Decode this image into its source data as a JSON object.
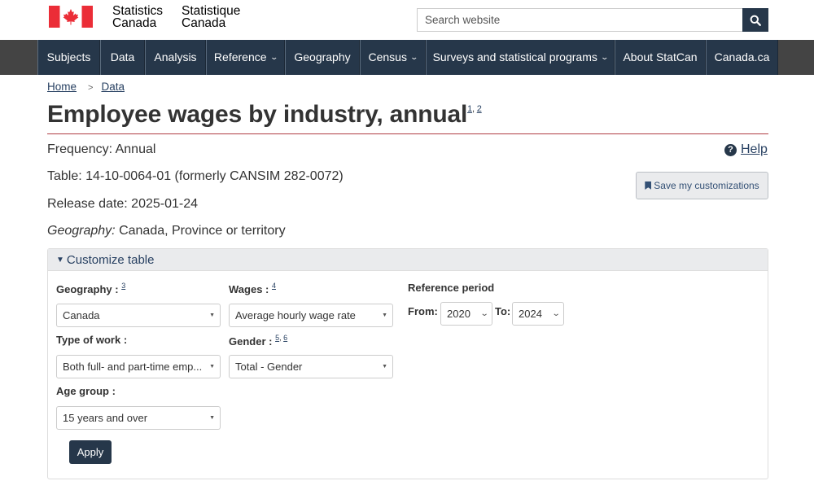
{
  "header": {
    "brand_en_1": "Statistics",
    "brand_en_2": "Canada",
    "brand_fr_1": "Statistique",
    "brand_fr_2": "Canada",
    "search_placeholder": "Search website",
    "search_icon": "search-icon"
  },
  "nav": {
    "items": [
      {
        "label": "Subjects",
        "dropdown": false
      },
      {
        "label": "Data",
        "dropdown": false
      },
      {
        "label": "Analysis",
        "dropdown": false
      },
      {
        "label": "Reference",
        "dropdown": true
      },
      {
        "label": "Geography",
        "dropdown": false
      },
      {
        "label": "Census",
        "dropdown": true
      },
      {
        "label": "Surveys and statistical programs",
        "dropdown": true
      },
      {
        "label": "About StatCan",
        "dropdown": false
      },
      {
        "label": "Canada.ca",
        "dropdown": false
      }
    ]
  },
  "breadcrumb": {
    "home": "Home",
    "separator": ">",
    "data": "Data"
  },
  "page": {
    "title": "Employee wages by industry, annual",
    "title_note_1": "1",
    "title_note_sep": ",",
    "title_note_2": "2",
    "frequency": "Frequency: Annual",
    "table": "Table: 14-10-0064-01 (formerly CANSIM 282-0072)",
    "release": "Release date: 2025-01-24",
    "geography_label": "Geography:",
    "geography_value": "Canada, Province or territory",
    "help": "Help",
    "save_button": "Save my customizations"
  },
  "customize": {
    "toggle": "Customize table",
    "geography": {
      "label": "Geography :",
      "note": "3",
      "value": "Canada"
    },
    "wages": {
      "label": "Wages :",
      "note": "4",
      "value": "Average hourly wage rate"
    },
    "reference_period": {
      "label": "Reference period",
      "from_label": "From:",
      "from_value": "2020",
      "to_label": "To:",
      "to_value": "2024"
    },
    "type_of_work": {
      "label": "Type of work :",
      "value": "Both full- and part-time emp..."
    },
    "gender": {
      "label": "Gender :",
      "note_1": "5",
      "note_sep": ",",
      "note_2": "6",
      "value": "Total - Gender"
    },
    "age_group": {
      "label": "Age group :",
      "value": "15 years and over"
    },
    "apply": "Apply"
  },
  "colors": {
    "nav_bg": "#26374a",
    "link": "#284162",
    "title_rule": "#af3c43",
    "flag_red": "#eb2d37"
  }
}
